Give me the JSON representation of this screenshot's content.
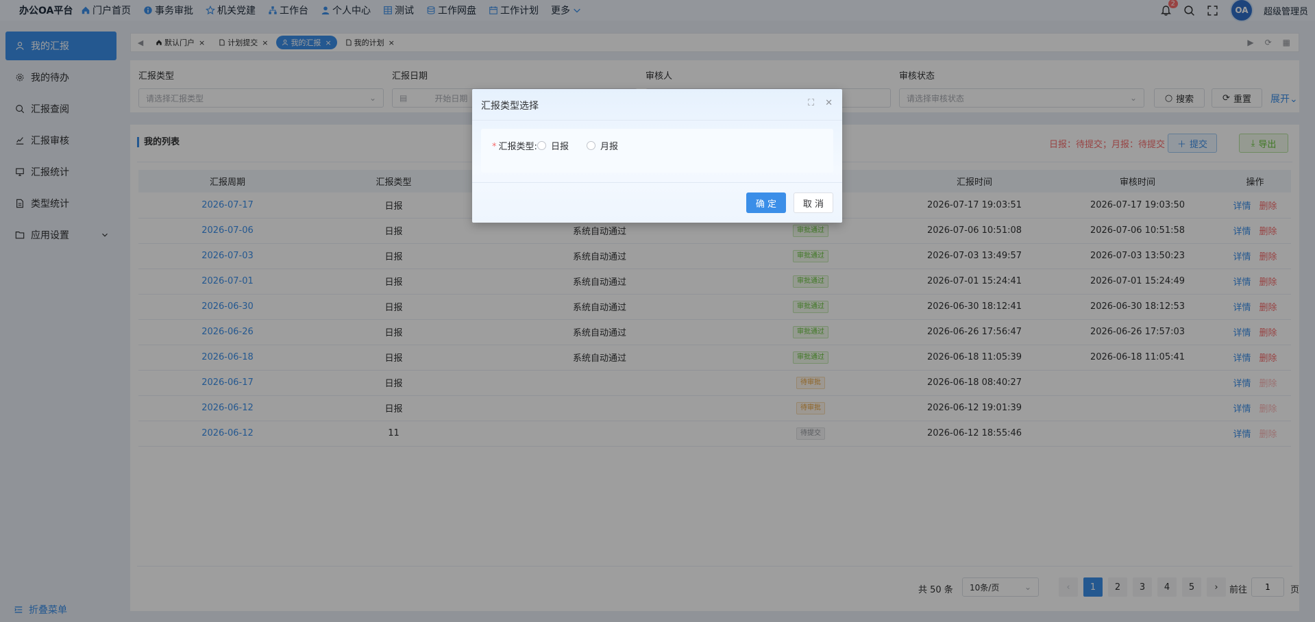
{
  "app": {
    "brand": "办公OA平台",
    "username": "超级管理员",
    "avatar_text": "OA",
    "notification_count": "2"
  },
  "nav": [
    {
      "label": "门户首页",
      "icon": "home-icon"
    },
    {
      "label": "事务审批",
      "icon": "info-icon"
    },
    {
      "label": "机关党建",
      "icon": "star-icon"
    },
    {
      "label": "工作台",
      "icon": "org-icon"
    },
    {
      "label": "个人中心",
      "icon": "user-icon"
    },
    {
      "label": "测试",
      "icon": "grid-icon"
    },
    {
      "label": "工作网盘",
      "icon": "database-icon"
    },
    {
      "label": "工作计划",
      "icon": "calendar-icon"
    },
    {
      "label": "更多",
      "icon": "chevron-down-icon"
    }
  ],
  "sidebar": {
    "items": [
      {
        "label": "我的汇报",
        "icon": "user-icon"
      },
      {
        "label": "我的待办",
        "icon": "gear-icon"
      },
      {
        "label": "汇报查阅",
        "icon": "search-icon"
      },
      {
        "label": "汇报审核",
        "icon": "audit-icon"
      },
      {
        "label": "汇报统计",
        "icon": "monitor-icon"
      },
      {
        "label": "类型统计",
        "icon": "document-icon"
      },
      {
        "label": "应用设置",
        "icon": "folder-icon"
      }
    ],
    "collapse_label": "折叠菜单"
  },
  "tabs": [
    {
      "label": "默认门户",
      "icon": "home-icon"
    },
    {
      "label": "计划提交",
      "icon": "document-icon"
    },
    {
      "label": "我的汇报",
      "icon": "user-icon"
    },
    {
      "label": "我的计划",
      "icon": "document-icon"
    }
  ],
  "filter": {
    "type_label": "汇报类型",
    "type_placeholder": "请选择汇报类型",
    "date_label": "汇报日期",
    "date_placeholder": "开始日期",
    "reviewer_label": "审核人",
    "status_label": "审核状态",
    "status_placeholder": "请选择审核状态",
    "search_label": "搜索",
    "reset_label": "重置",
    "expand_label": "展开"
  },
  "list": {
    "title": "我的列表",
    "status_text": "日报：待提交；月报：待提交",
    "submit_label": "提交",
    "export_label": "导出",
    "columns": [
      "汇报周期",
      "汇报类型",
      "",
      "",
      "汇报时间",
      "审核时间",
      "操作"
    ],
    "detail_label": "详情",
    "delete_label": "删除",
    "rows": [
      {
        "period": "2026-07-17",
        "type": "日报",
        "reviewer": "",
        "status": "",
        "status_kind": "",
        "report_time": "2026-07-17 19:03:51",
        "review_time": "2026-07-17 19:03:50",
        "delete_enabled": true
      },
      {
        "period": "2026-07-06",
        "type": "日报",
        "reviewer": "系统自动通过",
        "status": "审批通过",
        "status_kind": "pass",
        "report_time": "2026-07-06 10:51:08",
        "review_time": "2026-07-06 10:51:58",
        "delete_enabled": true
      },
      {
        "period": "2026-07-03",
        "type": "日报",
        "reviewer": "系统自动通过",
        "status": "审批通过",
        "status_kind": "pass",
        "report_time": "2026-07-03 13:49:57",
        "review_time": "2026-07-03 13:50:23",
        "delete_enabled": true
      },
      {
        "period": "2026-07-01",
        "type": "日报",
        "reviewer": "系统自动通过",
        "status": "审批通过",
        "status_kind": "pass",
        "report_time": "2026-07-01 15:24:41",
        "review_time": "2026-07-01 15:24:49",
        "delete_enabled": true
      },
      {
        "period": "2026-06-30",
        "type": "日报",
        "reviewer": "系统自动通过",
        "status": "审批通过",
        "status_kind": "pass",
        "report_time": "2026-06-30 18:12:41",
        "review_time": "2026-06-30 18:12:53",
        "delete_enabled": true
      },
      {
        "period": "2026-06-26",
        "type": "日报",
        "reviewer": "系统自动通过",
        "status": "审批通过",
        "status_kind": "pass",
        "report_time": "2026-06-26 17:56:47",
        "review_time": "2026-06-26 17:57:03",
        "delete_enabled": true
      },
      {
        "period": "2026-06-18",
        "type": "日报",
        "reviewer": "系统自动通过",
        "status": "审批通过",
        "status_kind": "pass",
        "report_time": "2026-06-18 11:05:39",
        "review_time": "2026-06-18 11:05:41",
        "delete_enabled": true
      },
      {
        "period": "2026-06-17",
        "type": "日报",
        "reviewer": "",
        "status": "待审批",
        "status_kind": "wait",
        "report_time": "2026-06-18 08:40:27",
        "review_time": "",
        "delete_enabled": false
      },
      {
        "period": "2026-06-12",
        "type": "日报",
        "reviewer": "",
        "status": "待审批",
        "status_kind": "wait",
        "report_time": "2026-06-12 19:01:39",
        "review_time": "",
        "delete_enabled": false
      },
      {
        "period": "2026-06-12",
        "type": "11",
        "reviewer": "",
        "status": "待提交",
        "status_kind": "draft",
        "report_time": "2026-06-12 18:55:46",
        "review_time": "",
        "delete_enabled": false
      }
    ]
  },
  "pager": {
    "total": "共 50 条",
    "page_size": "10条/页",
    "pages": [
      "1",
      "2",
      "3",
      "4",
      "5"
    ],
    "current": "1",
    "goto_label": "前往",
    "goto_value": "1",
    "page_suffix": "页"
  },
  "dialog": {
    "title": "汇报类型选择",
    "field_label": "汇报类型:",
    "required_mark": "*",
    "options": [
      "日报",
      "月报"
    ],
    "ok_label": "确 定",
    "cancel_label": "取 消"
  },
  "colors": {
    "accent": "#3b8ee8",
    "danger": "#f56c6c",
    "success": "#67c23a",
    "warning": "#e6a23c"
  }
}
